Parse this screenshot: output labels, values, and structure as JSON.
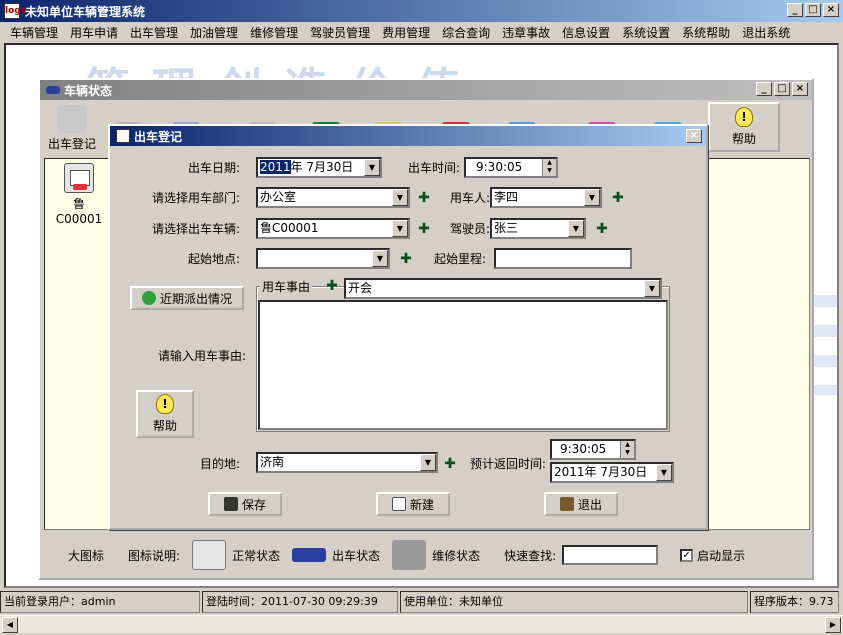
{
  "app": {
    "title": "未知单位车辆管理系统",
    "logo": "logo",
    "minimize": "_",
    "maximize": "□",
    "close": "×"
  },
  "menu": [
    "车辆管理",
    "用车申请",
    "出车管理",
    "加油管理",
    "维修管理",
    "驾驶员管理",
    "费用管理",
    "综合查询",
    "违章事故",
    "信息设置",
    "系统设置",
    "系统帮助",
    "退出系统"
  ],
  "desktop": {
    "banner": "管理创造价值"
  },
  "vehicle_status": {
    "title": "车辆状态",
    "toolbar_first_label": "出车登记",
    "help_label": "帮助",
    "vehicle_plate": "鲁C00001",
    "footer": {
      "large_icons": "大图标",
      "legend_label": "图标说明:",
      "normal": "正常状态",
      "out": "出车状态",
      "repair": "维修状态",
      "quick_search": "快速查找:",
      "auto_show": "启动显示"
    }
  },
  "dialog": {
    "title": "出车登记",
    "close": "×",
    "out_date_label": "出车日期:",
    "out_date_sel": "2011",
    "out_date_rest": "年 7月30日",
    "out_time_label": "出车时间:",
    "out_time": "9:30:05",
    "dept_label": "请选择用车部门:",
    "dept": "办公室",
    "user_label": "用车人:",
    "user": "李四",
    "vehicle_label": "请选择出车车辆:",
    "vehicle": "鲁C00001",
    "driver_label": "驾驶员:",
    "driver": "张三",
    "start_place_label": "起始地点:",
    "start_place": "",
    "start_mileage_label": "起始里程:",
    "start_mileage": "",
    "recent_btn": "近期派出情况",
    "reason_group_label": "用车事由",
    "reason_select": "开会",
    "reason_input_label": "请输入用车事由:",
    "help_label": "帮助",
    "dest_label": "目的地:",
    "dest": "济南",
    "return_label": "预计返回时间:",
    "return_time": "9:30:05",
    "return_date": "2011年 7月30日",
    "save_btn": "保存",
    "new_btn": "新建",
    "exit_btn": "退出",
    "plus": "✚",
    "dd": "▼",
    "help_glyph": "!"
  },
  "status": {
    "user": "当前登录用户：admin",
    "login_time": "登陆时间：2011-07-30 09:29:39",
    "unit": "使用单位：未知单位",
    "version": "程序版本：9.73"
  },
  "scroll": {
    "left": "◀",
    "right": "▶"
  }
}
